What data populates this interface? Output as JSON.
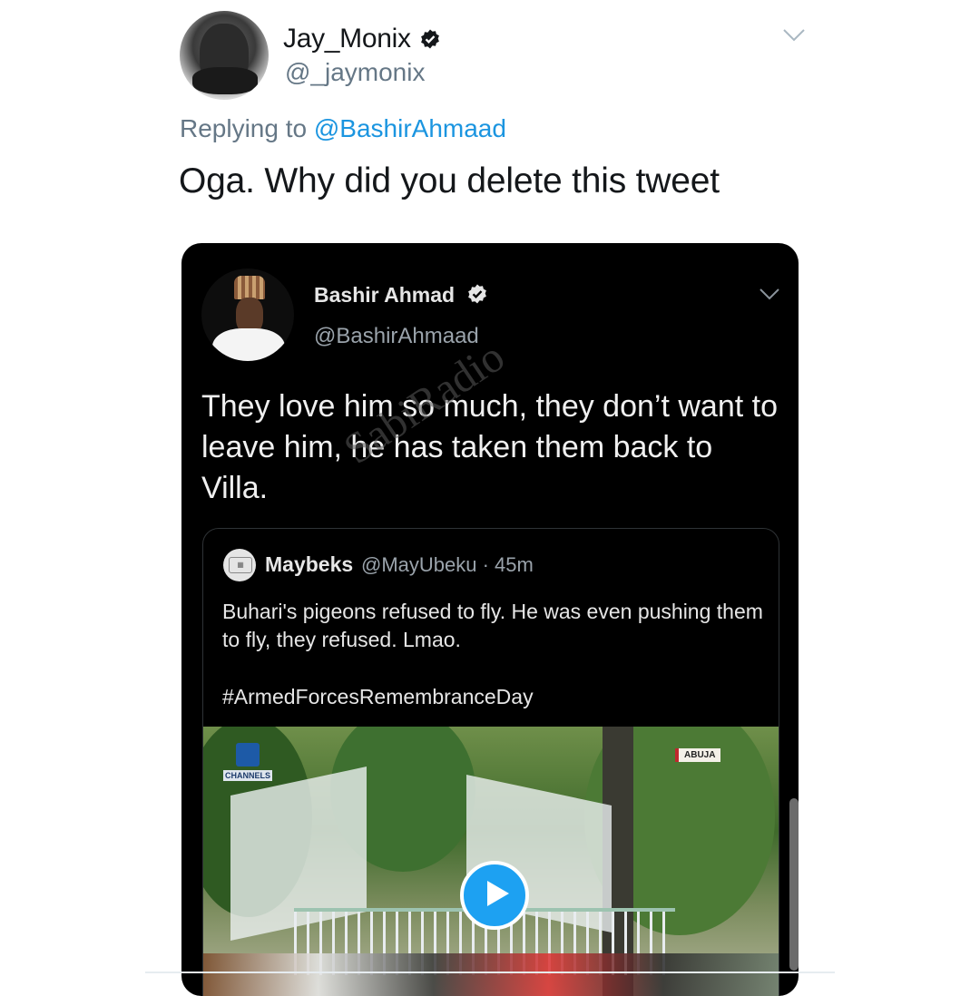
{
  "outer_tweet": {
    "display_name": "Jay_Monix",
    "handle": "@_jaymonix",
    "replying_prefix": "Replying to",
    "replying_to": "@BashirAhmaad",
    "text": "Oga. Why did you delete this tweet"
  },
  "embedded_tweet": {
    "display_name": "Bashir Ahmad",
    "handle": "@BashirAhmaad",
    "text": "They love him so much, they don’t want to leave him, he has taken them back to Villa.",
    "watermark": "SabiRadio"
  },
  "quoted_tweet": {
    "display_name": "Maybeks",
    "handle_time": "@MayUbeku · 45m",
    "text": "Buhari's pigeons refused to fly. He was even pushing them to fly, they refused. Lmao.",
    "hashtag": "#ArmedForcesRemembranceDay"
  },
  "video": {
    "channel_label": "CHANNELS",
    "location_tag": "ABUJA"
  },
  "icons": {
    "verified": "verified-badge-icon",
    "caret": "chevron-down-icon",
    "play": "play-icon"
  },
  "colors": {
    "mention": "#1b95e0",
    "secondary_text": "#657786",
    "dark_bg": "#000000",
    "play_button": "#1da1f2"
  }
}
